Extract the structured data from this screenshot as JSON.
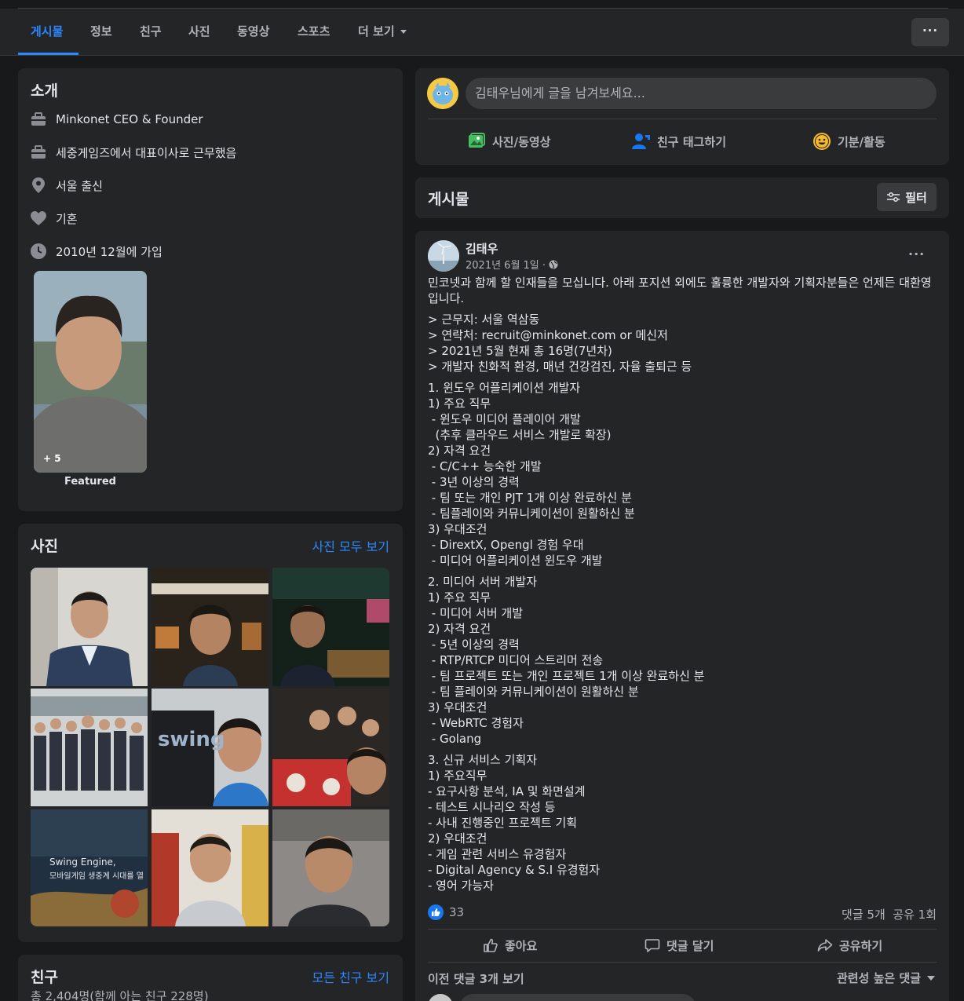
{
  "tabs": [
    {
      "label": "게시물",
      "active": true
    },
    {
      "label": "정보"
    },
    {
      "label": "친구"
    },
    {
      "label": "사진"
    },
    {
      "label": "동영상"
    },
    {
      "label": "스포츠"
    },
    {
      "label": "더 보기"
    }
  ],
  "more_button_label": "···",
  "intro": {
    "title": "소개",
    "items": [
      {
        "icon": "briefcase-icon",
        "text": "Minkonet CEO & Founder"
      },
      {
        "icon": "briefcase-icon",
        "text": "세중게임즈에서 대표이사로 근무했음"
      },
      {
        "icon": "location-pin-icon",
        "text": "서울 출신"
      },
      {
        "icon": "heart-icon",
        "text": "기혼"
      },
      {
        "icon": "clock-icon",
        "text": "2010년 12월에 가입"
      }
    ],
    "featured_count": "+ 5",
    "featured_label": "Featured"
  },
  "photos": {
    "title": "사진",
    "see_all": "사진 모두 보기",
    "overlay_text_1": "swing",
    "overlay_text_2": "Swing Engine,",
    "overlay_text_3": "모바일게임 생중계 시대를 열"
  },
  "friends": {
    "title": "친구",
    "see_all": "모든 친구 보기",
    "count_text": "총 2,404명(함께 아는 친구 228명)"
  },
  "composer": {
    "placeholder": "김태우님에게 글을 남겨보세요...",
    "actions": [
      {
        "icon": "photo-video-icon",
        "label": "사진/동영상"
      },
      {
        "icon": "tag-friends-icon",
        "label": "친구 태그하기"
      },
      {
        "icon": "feeling-icon",
        "label": "기분/활동"
      }
    ]
  },
  "posts_header": {
    "title": "게시물",
    "filter_label": "필터"
  },
  "post": {
    "author": "김태우",
    "date": "2021년 6월 1일 ·",
    "options": "···",
    "intro": "민코넷과 함께 할 인재들을 모십니다. 아래 포지션 외에도 훌륭한 개발자와 기획자분들은 언제든 대환영입니다.",
    "block1": "> 근무지: 서울 역삼동\n> 연락처: recruit@minkonet.com or 메신저\n> 2021년 5월 현재 총 16명(7년차)\n> 개발자 친화적 환경, 매년 건강검진, 자율 출퇴근 등",
    "block2": "1. 윈도우 어플리케이션 개발자\n1) 주요 직무\n - 윈도우 미디어 플레이어 개발\n  (추후 클라우드 서비스 개발로 확장)\n2) 자격 요건\n - C/C++ 능숙한 개발\n - 3년 이상의 경력\n - 팀 또는 개인 PJT 1개 이상 완료하신 분\n - 팀플레이와 커뮤니케이션이 원활하신 분\n3) 우대조건\n - DirextX, Opengl 경험 우대\n - 미디어 어플리케이션 윈도우 개발",
    "block3": "2. 미디어 서버 개발자\n1) 주요 직무\n - 미디어 서버 개발\n2) 자격 요건\n - 5년 이상의 경력\n - RTP/RTCP 미디어 스트리머 전송\n - 팀 프로젝트 또는 개인 프로젝트 1개 이상 완료하신 분\n - 팀 플레이와 커뮤니케이션이 원활하신 분\n3) 우대조건\n - WebRTC 경험자\n - Golang",
    "block4": "3. 신규 서비스 기획자\n1) 주요직무\n- 요구사항 분석, IA 및 화면설계\n- 테스트 시나리오 작성 등\n- 사내 진행중인 프로젝트 기획\n2) 우대조건\n- 게임 관련 서비스 유경험자\n- Digital Agency & S.I 유경험자\n- 영어 가능자",
    "like_count": "33",
    "comments_shares": "댓글 5개  공유 1회",
    "like_label": "좋아요",
    "comment_label": "댓글 달기",
    "share_label": "공유하기",
    "prev_comments": "이전 댓글 3개 보기",
    "sort_label": "관련성 높은 댓글"
  },
  "colors": {
    "accent": "#2d88ff",
    "background": "#18191a",
    "card": "#242526"
  }
}
